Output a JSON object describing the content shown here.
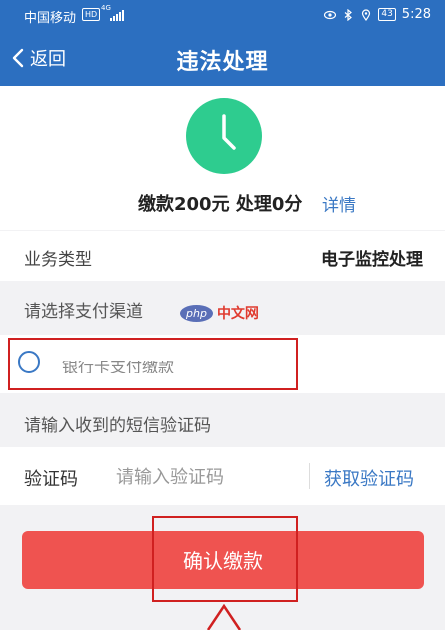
{
  "status_bar": {
    "carrier": "中国移动",
    "hd_badge": "HD",
    "network": "4G",
    "battery": "43",
    "time": "5:28"
  },
  "nav": {
    "back_label": "返回",
    "title": "违法处理"
  },
  "summary": {
    "text": "缴款200元 处理0分",
    "detail_link": "详情",
    "icon": "clock-icon",
    "icon_color": "#2ecc8f"
  },
  "business": {
    "label": "业务类型",
    "value": "电子监控处理"
  },
  "payment": {
    "section_title": "请选择支付渠道",
    "option_label": "银行卡支付缴款"
  },
  "sms": {
    "section_title": "请输入收到的短信验证码",
    "code_label": "验证码",
    "code_placeholder": "请输入验证码",
    "get_code_label": "获取验证码"
  },
  "confirm": {
    "label": "确认缴款"
  },
  "watermark": {
    "badge": "php",
    "text": "中文网"
  },
  "colors": {
    "brand_blue": "#2c6fc0",
    "link_blue": "#3a78c4",
    "confirm_red": "#ef5350",
    "annotation_red": "#d02020"
  }
}
